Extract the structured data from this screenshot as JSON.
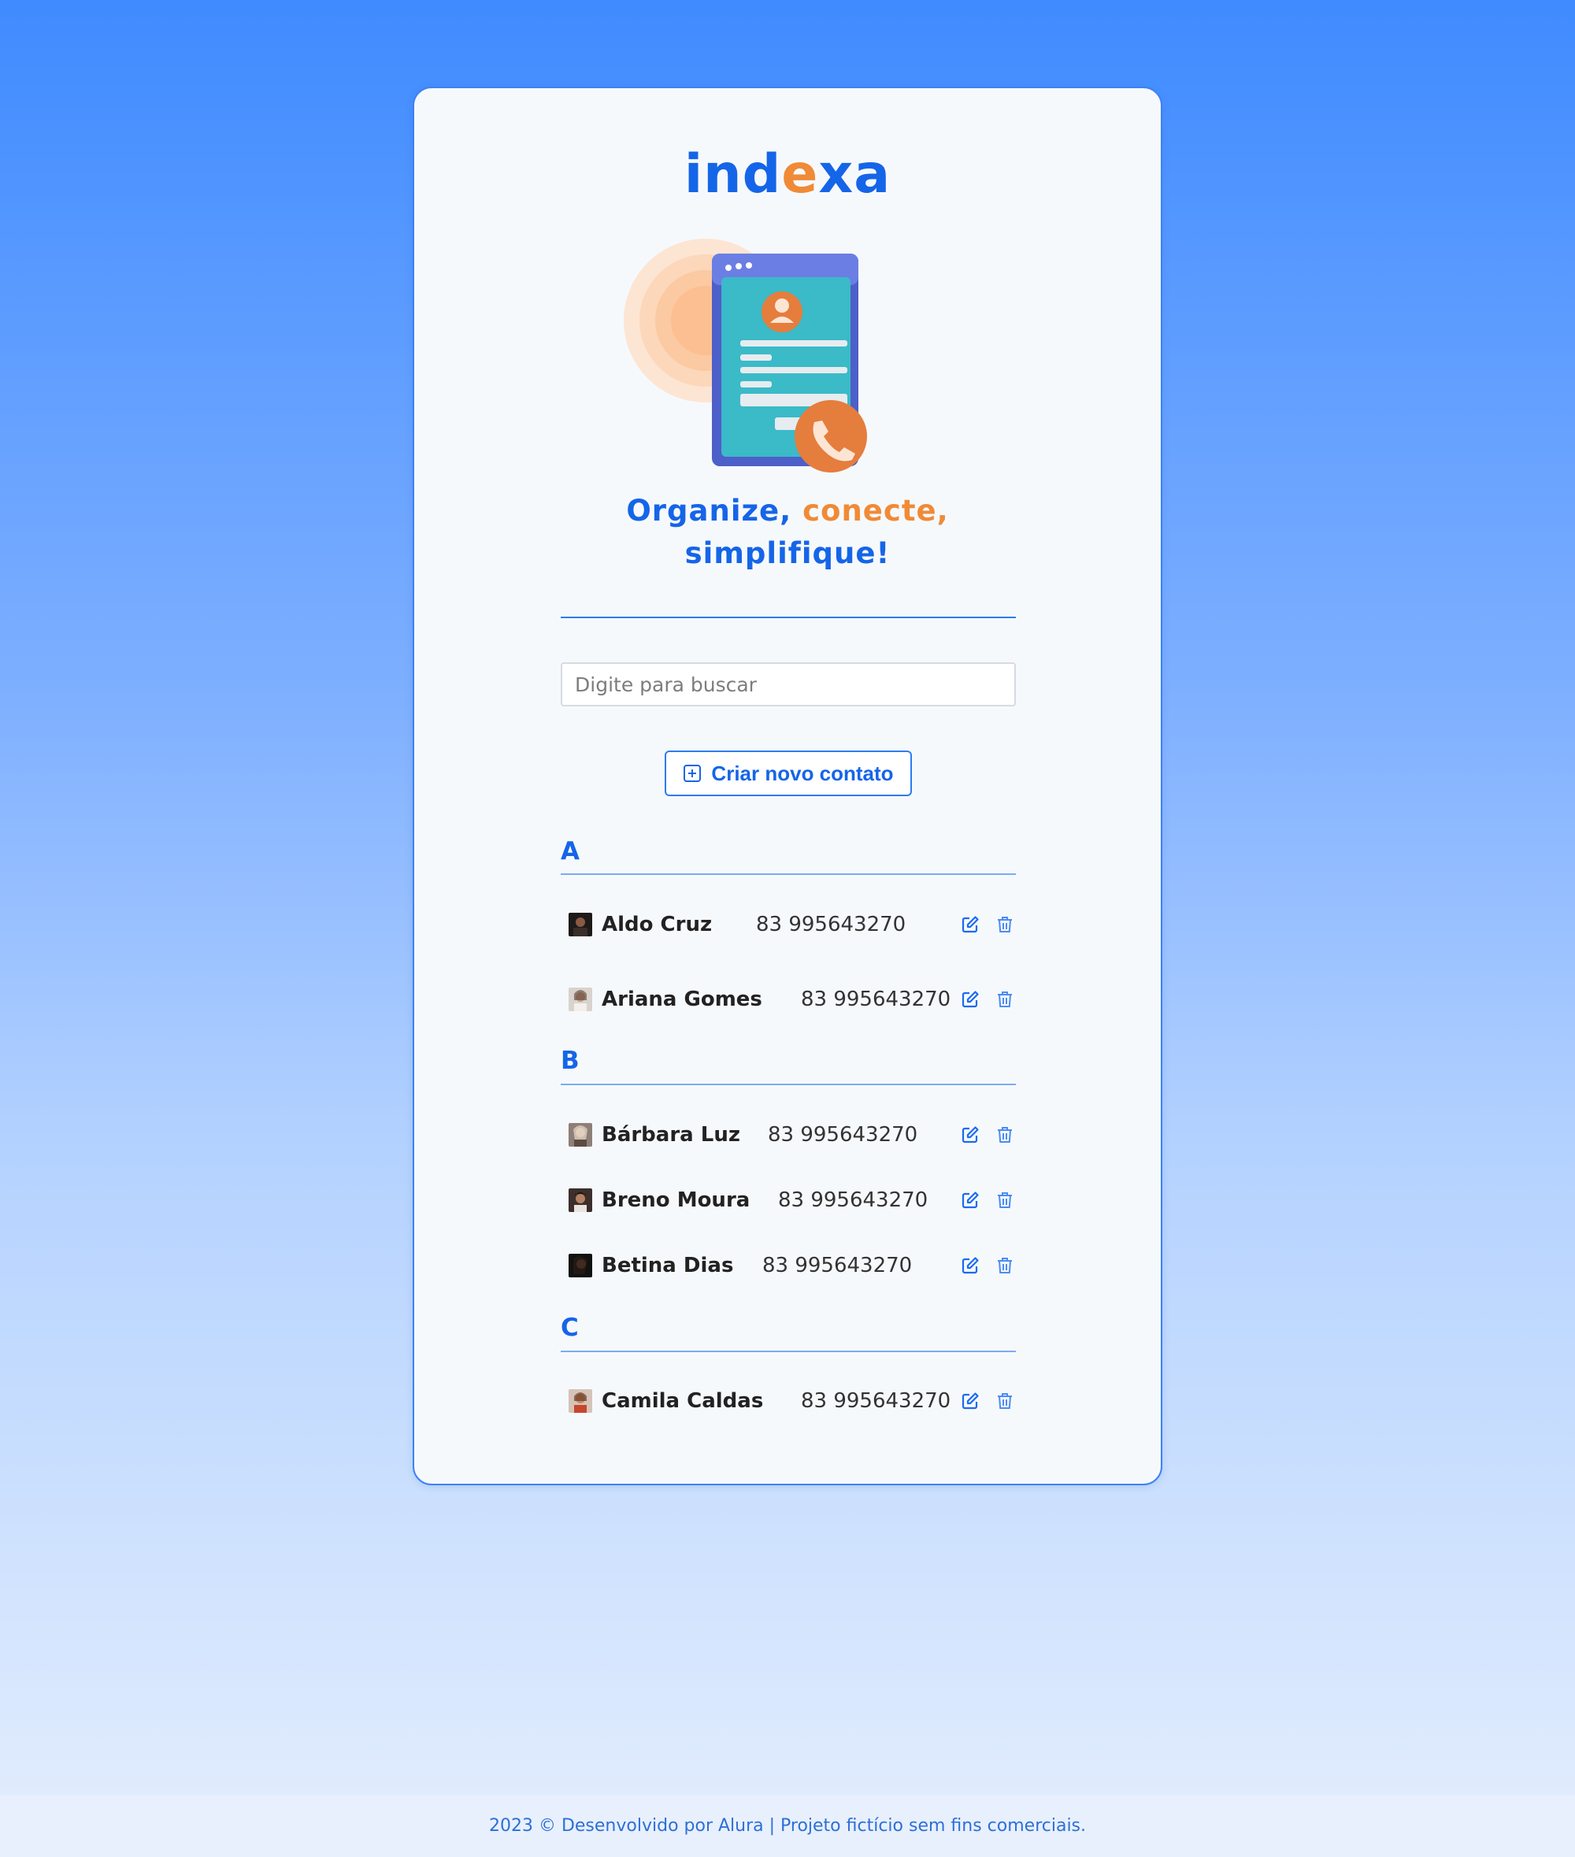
{
  "brand": {
    "logo_prefix": "ind",
    "logo_mid": "e",
    "logo_suffix": "xa"
  },
  "tagline": {
    "part1": "Organize, ",
    "part2": "conecte,",
    "part3": "simplifique!"
  },
  "search": {
    "placeholder": "Digite para buscar",
    "value": ""
  },
  "create_button": {
    "label": "Criar novo contato",
    "icon": "plus-square-icon"
  },
  "groups": [
    {
      "letter": "A",
      "contacts": [
        {
          "name": "Aldo Cruz",
          "phone": "83 995643270"
        },
        {
          "name": "Ariana Gomes",
          "phone": "83 995643270"
        }
      ]
    },
    {
      "letter": "B",
      "contacts": [
        {
          "name": "Bárbara Luz",
          "phone": "83 995643270"
        },
        {
          "name": "Breno Moura",
          "phone": "83 995643270"
        },
        {
          "name": "Betina Dias",
          "phone": "83 995643270"
        }
      ]
    },
    {
      "letter": "C",
      "contacts": [
        {
          "name": "Camila Caldas",
          "phone": "83 995643270"
        }
      ]
    }
  ],
  "row_icons": {
    "edit": "edit-icon",
    "delete": "trash-icon"
  },
  "footer": {
    "text": "2023 © Desenvolvido por Alura | Projeto fictício sem fins comerciais."
  },
  "colors": {
    "primary": "#1565e8",
    "accent": "#f08a36",
    "card_bg": "#f6f9fc",
    "text": "#222222"
  }
}
